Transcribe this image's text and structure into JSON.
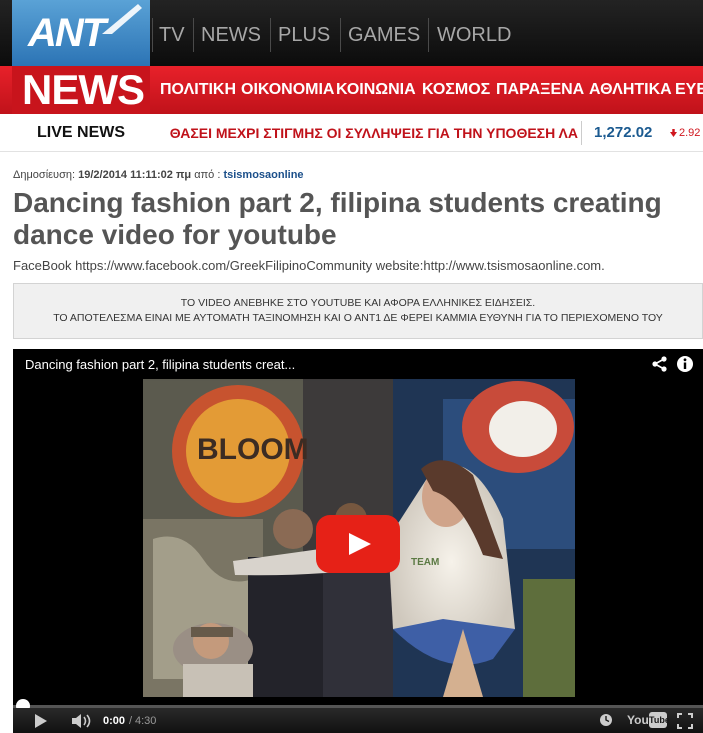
{
  "brand": {
    "logo_text": "ANT",
    "news_logo_text": "NEWS"
  },
  "top_nav": {
    "items": [
      {
        "label": "TV"
      },
      {
        "label": "NEWS"
      },
      {
        "label": "PLUS"
      },
      {
        "label": "GAMES"
      },
      {
        "label": "WORLD"
      }
    ]
  },
  "category_nav": {
    "items": [
      {
        "label": "ΠΟΛΙΤΙΚΗ"
      },
      {
        "label": "ΟΙΚΟΝΟΜΙΑ"
      },
      {
        "label": "ΚΟΙΝΩΝΙΑ"
      },
      {
        "label": "ΚΟΣΜΟΣ"
      },
      {
        "label": "ΠΑΡΑΞΕΝΑ"
      },
      {
        "label": "ΑΘΛΗΤΙΚΑ"
      },
      {
        "label": "ΕΥΕ"
      }
    ]
  },
  "live_news": {
    "label": "LIVE NEWS",
    "ticker": "ΘΑΣΕΙ ΜΕΧΡΙ ΣΤΙΓΜΗΣ ΟΙ ΣΥΛΛΗΨΕΙΣ ΓΙΑ ΤΗΝ ΥΠΟΘΕΣΗ ΛΑ",
    "stock_value": "1,272.02",
    "stock_change": "2.92"
  },
  "article": {
    "meta_prefix": "Δημοσίευση:",
    "date": "19/2/2014 11:11:02 πμ",
    "by": "από :",
    "author": "tsismosaonline",
    "title": "Dancing fashion part 2, filipina students creating dance video for youtube",
    "description": "FaceBook https://www.facebook.com/GreekFilipinoCommunity website:http://www.tsismosaonline.com."
  },
  "disclaimer": {
    "line1": "ΤΟ VIDEO ΑΝΕΒΗΚΕ ΣΤΟ YOUTUBE ΚΑΙ ΑΦΟΡΑ ΕΛΛΗΝΙΚΕΣ ΕΙΔΗΣΕΙΣ.",
    "line2": "ΤΟ ΑΠΟΤΕΛΕΣΜΑ ΕΙΝΑΙ ΜΕ ΑΥΤΟΜΑΤΗ ΤΑΞΙΝΟΜΗΣΗ ΚΑΙ Ο ΑΝΤ1 ΔΕ ΦΕΡΕΙ ΚΑΜΜΙΑ ΕΥΘΥΝΗ ΓΙΑ ΤΟ ΠΕΡΙΕΧΟΜΕΝΟ ΤΟΥ"
  },
  "player": {
    "video_title": "Dancing fashion part 2, filipina students creat...",
    "time_current": "0:00",
    "time_separator": "/",
    "time_total": "4:30",
    "progress_fraction": 0.0,
    "yt_logo_you": "You",
    "yt_logo_tube": "Tube",
    "graffiti_text": "BLOOM",
    "shirt_text": "TEAM"
  },
  "icons": {
    "share": "share-icon",
    "info": "info-icon",
    "play_large": "play-icon",
    "play_control": "play-icon",
    "volume": "volume-icon",
    "watch_later": "clock-icon",
    "fullscreen": "fullscreen-icon",
    "stock_down": "arrow-down-icon"
  },
  "colors": {
    "brand_red": "#e8212a",
    "ant_blue": "#3d88c8",
    "ticker_red": "#c0121a",
    "stock_blue": "#1b5a90",
    "yt_red": "#e62117"
  }
}
